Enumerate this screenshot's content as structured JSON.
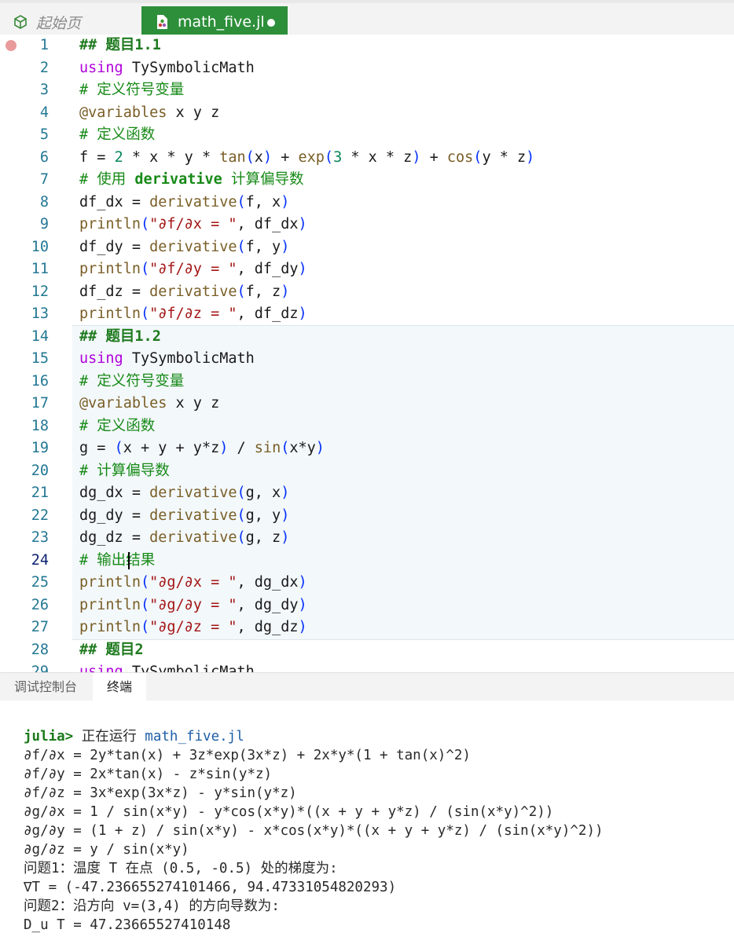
{
  "tabs": {
    "start_label": "起始页",
    "file_label": "math_five.jl"
  },
  "editor": {
    "line_numbers": [
      "1",
      "2",
      "3",
      "4",
      "5",
      "6",
      "7",
      "8",
      "9",
      "10",
      "11",
      "12",
      "13",
      "14",
      "15",
      "16",
      "17",
      "18",
      "19",
      "20",
      "21",
      "22",
      "23",
      "24",
      "25",
      "26",
      "27",
      "28",
      "29"
    ],
    "h1": "## 题目1.1",
    "using": "using",
    "pkg": "TySymbolicMath",
    "c_def_vars": "# 定义符号变量",
    "variables_macro": "@variables",
    "variables_args": " x y z",
    "c_def_func": "# 定义函数",
    "c_use": "# 使用 ",
    "c_derivative": "derivative",
    "c_calc": " 计算偏导数",
    "h12": "## 题目1.2",
    "c_calc2": "# 计算偏导数",
    "c_output": "# 输出结果",
    "h2": "## 题目2",
    "s_dfdx": "\"∂f/∂x = \"",
    "s_dfdy": "\"∂f/∂y = \"",
    "s_dfdz": "\"∂f/∂z = \"",
    "s_dgdx": "\"∂g/∂x = \"",
    "s_dgdy": "\"∂g/∂y = \"",
    "s_dgdz": "\"∂g/∂z = \"",
    "n2": "2",
    "n3": "3"
  },
  "panel": {
    "tab_debug": "调试控制台",
    "tab_terminal": "终端"
  },
  "terminal": {
    "prompt": "julia>",
    "running": " 正在运行 ",
    "file": "math_five.jl",
    "lines": [
      "∂f/∂x = 2y*tan(x) + 3z*exp(3x*z) + 2x*y*(1 + tan(x)^2)",
      "∂f/∂y = 2x*tan(x) - z*sin(y*z)",
      "∂f/∂z = 3x*exp(3x*z) - y*sin(y*z)",
      "∂g/∂x = 1 / sin(x*y) - y*cos(x*y)*((x + y + y*z) / (sin(x*y)^2))",
      "∂g/∂y = (1 + z) / sin(x*y) - x*cos(x*y)*((x + y + y*z) / (sin(x*y)^2))",
      "∂g/∂z = y / sin(x*y)",
      "问题1：温度 T 在点 (0.5, -0.5) 处的梯度为:",
      "∇T = (-47.236655274101466, 94.47331054820293)",
      "问题2：沿方向 v=(3,4) 的方向导数为:",
      "D_u T = 47.23665527410148"
    ]
  },
  "colors": {
    "tab_active_bg": "#2d8f3a",
    "breakpoint": "#e99a9a"
  }
}
